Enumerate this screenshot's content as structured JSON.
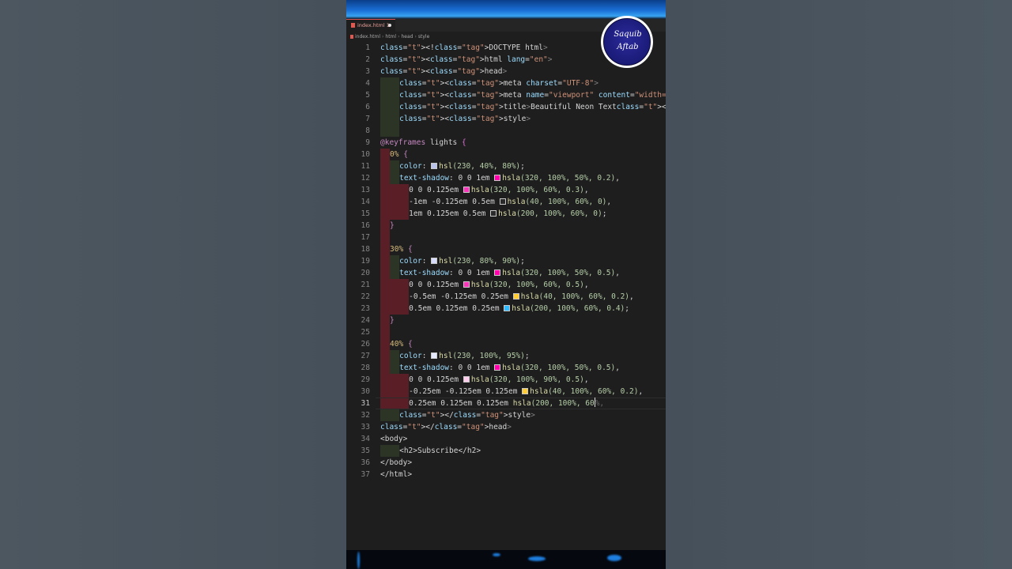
{
  "tab": {
    "filename": "index.html",
    "badge": "1"
  },
  "breadcrumb": [
    "index.html",
    "html",
    "head",
    "style"
  ],
  "logo_text": [
    "Saquib",
    "Aftab"
  ],
  "active_line": 31,
  "lines": [
    "<!DOCTYPE html>",
    "<html lang=\"en\">",
    "<head>",
    "<meta charset=\"UTF-8\">",
    "<meta name=\"viewport\" content=\"width=device-width, initi",
    "<title>Beautiful Neon Text</title>",
    "<style>",
    "",
    "@keyframes lights {",
    "0% {",
    "color: hsl(230, 40%, 80%);",
    "text-shadow: 0 0 1em hsla(320, 100%, 50%, 0.2),",
    "0 0 0.125em hsla(320, 100%, 60%, 0.3),",
    "-1em -0.125em 0.5em hsla(40, 100%, 60%, 0),",
    "1em 0.125em 0.5em hsla(200, 100%, 60%, 0);",
    "}",
    "",
    "30% {",
    "color: hsl(230, 80%, 90%);",
    "text-shadow: 0 0 1em hsla(320, 100%, 50%, 0.5),",
    "0 0 0.125em hsla(320, 100%, 60%, 0.5),",
    "-0.5em -0.125em 0.25em hsla(40, 100%, 60%, 0.2),",
    "0.5em 0.125em 0.25em hsla(200, 100%, 60%, 0.4);",
    "}",
    "",
    "40% {",
    "color: hsl(230, 100%, 95%);",
    "text-shadow: 0 0 1em hsla(320, 100%, 50%, 0.5),",
    "0 0 0.125em hsla(320, 100%, 90%, 0.5),",
    "-0.25em -0.125em 0.125em hsla(40, 100%, 60%, 0.2),",
    "0.25em 0.125em 0.125em hsla(200, 100%, 60%,",
    "</style>",
    "</head>",
    "<body>",
    "<h2>Subscribe</h2>",
    "</body>",
    "</html>"
  ],
  "colors": {
    "accent_red": "#e0584f",
    "editor_bg": "#1e1e1e",
    "tag": "#569cd6",
    "string": "#ce9178",
    "number": "#b5cea8",
    "function": "#dcdcaa"
  }
}
